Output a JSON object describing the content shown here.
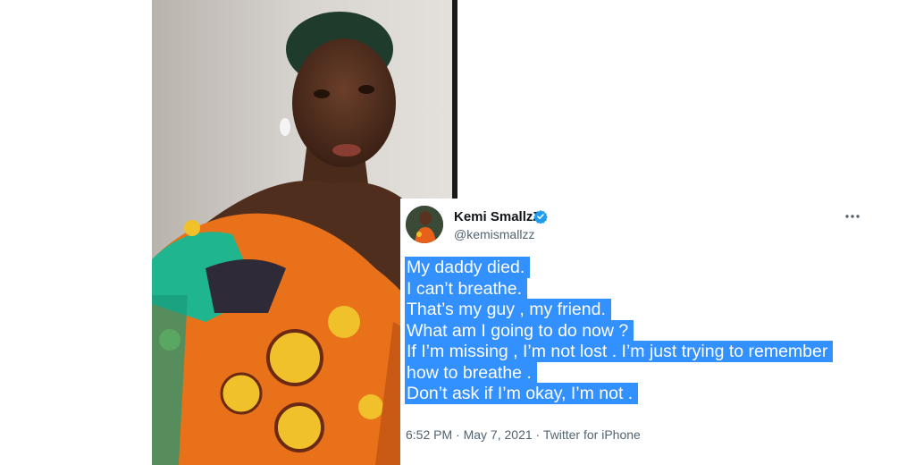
{
  "tweet": {
    "display_name": "Kemi SmallzZ",
    "handle": "@kemismallzz",
    "icons": {
      "verified": "verified-badge-icon",
      "more": "more-options-icon",
      "avatar": "avatar-photo"
    },
    "lines": [
      "My daddy died.",
      "I can’t breathe.",
      "That’s my guy , my friend.",
      "What am I going to do now ?",
      "If I’m missing , I’m not lost . I’m just trying to remember",
      "how to breathe .",
      "Don’t ask if I’m okay, I’m not ."
    ],
    "time": "6:52 PM",
    "separator": "·",
    "date": "May 7, 2021",
    "source": "Twitter for iPhone",
    "colors": {
      "highlight": "#3390ff",
      "verified": "#1d9bf0",
      "text": "#0f1419",
      "muted": "#536471"
    }
  }
}
